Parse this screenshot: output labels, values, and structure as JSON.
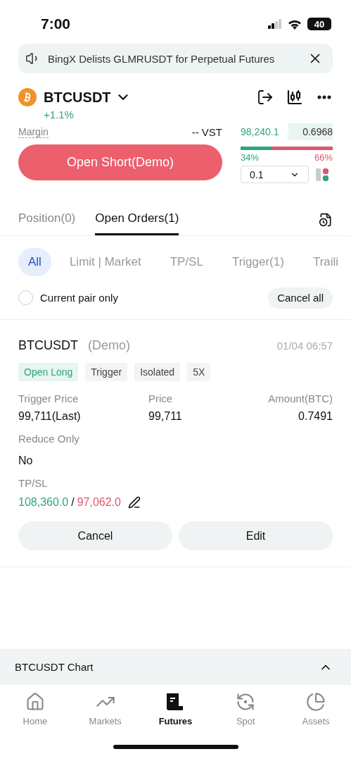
{
  "status_bar": {
    "time": "7:00",
    "battery": "40"
  },
  "announcement": {
    "text": "BingX Delists GLMRUSDT  for Perpetual Futures"
  },
  "symbol": {
    "name": "BTCUSDT",
    "change": "+1.1%"
  },
  "margin": {
    "label": "Margin",
    "value": "-- VST"
  },
  "order_book": {
    "price": "98,240.1",
    "amount": "0.6968",
    "ratio": {
      "level": 0.34,
      "buy": "34%",
      "sell": "66%"
    },
    "precision": "0.1"
  },
  "primary_button": {
    "label": "Open Short(Demo)"
  },
  "tabs": [
    {
      "label": "Position(0)",
      "selected": false
    },
    {
      "label": "Open Orders(1)",
      "selected": true
    }
  ],
  "filters": [
    {
      "label": "All",
      "selected": true
    },
    {
      "label": "Limit | Market",
      "selected": false
    },
    {
      "label": "TP/SL",
      "selected": false
    },
    {
      "label": "Trigger(1)",
      "selected": false
    },
    {
      "label": "Traili",
      "selected": false
    }
  ],
  "current_pair_only": {
    "label": "Current pair only",
    "checked": false
  },
  "cancel_all": "Cancel all",
  "order": {
    "symbol": "BTCUSDT",
    "mode": "(Demo)",
    "time": "01/04 06:57",
    "tags": [
      {
        "label": "Open Long",
        "kind": "side"
      },
      {
        "label": "Trigger",
        "kind": "plain"
      },
      {
        "label": "Isolated",
        "kind": "plain"
      },
      {
        "label": "5X",
        "kind": "plain"
      }
    ],
    "fields": [
      {
        "label": "Trigger Price",
        "value": "99,711(Last)"
      },
      {
        "label": "Price",
        "value": "99,711"
      },
      {
        "label": "Amount(BTC)",
        "value": "0.7491"
      }
    ],
    "reduce_only": {
      "label": "Reduce Only",
      "value": "No"
    },
    "tpsl": {
      "label": "TP/SL",
      "tp": "108,360.0",
      "separator": "/",
      "sl": "97,062.0"
    },
    "buttons": [
      "Cancel",
      "Edit"
    ]
  },
  "chart_bar": {
    "label": "BTCUSDT Chart"
  },
  "nav": [
    {
      "label": "Home",
      "selected": false
    },
    {
      "label": "Markets",
      "selected": false
    },
    {
      "label": "Futures",
      "selected": true
    },
    {
      "label": "Spot",
      "selected": false
    },
    {
      "label": "Assets",
      "selected": false
    }
  ]
}
